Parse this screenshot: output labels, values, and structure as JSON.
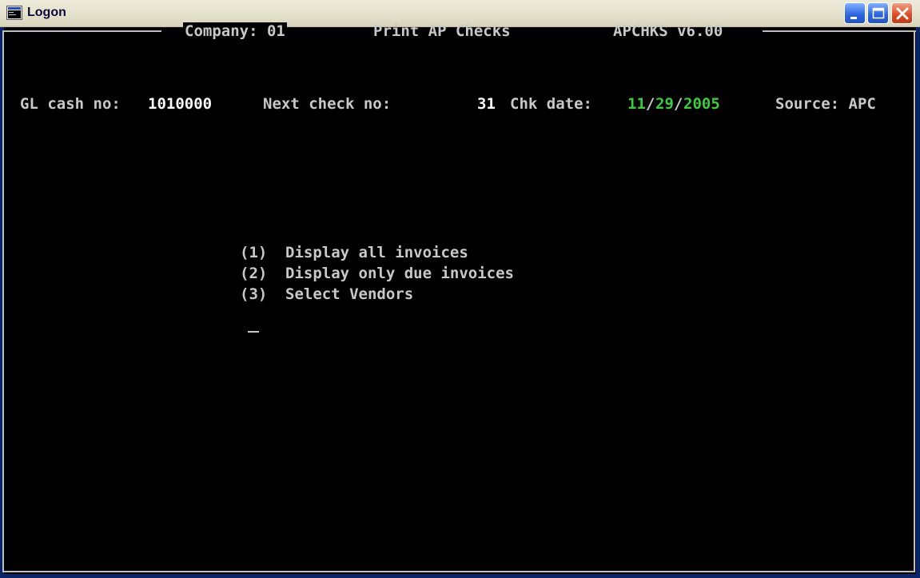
{
  "window": {
    "title": "Logon",
    "icon": "console-window-icon",
    "controls": {
      "minimize": "minimize-icon",
      "maximize": "maximize-icon",
      "close": "close-icon"
    }
  },
  "header": {
    "company": "Company: 01",
    "program_title": "Print AP Checks",
    "program_version": "APCHKS v6.00"
  },
  "info_line": {
    "gl_label": "GL cash no:",
    "gl_value": "1010000",
    "next_check_label": "Next check no:",
    "next_check_value": "31",
    "chk_date_label": "Chk date:",
    "chk_date_month": "11",
    "chk_date_day": "29",
    "chk_date_year": "2005",
    "chk_date_sep1": "/",
    "chk_date_sep2": "/",
    "source": "Source: APC"
  },
  "menu": {
    "items": [
      {
        "key": "(1)",
        "label": "Display all invoices"
      },
      {
        "key": "(2)",
        "label": "Display only due invoices"
      },
      {
        "key": "(3)",
        "label": "Select Vendors"
      }
    ]
  },
  "colors": {
    "background": "#000000",
    "text": "#c8c8c8",
    "highlight": "#ffffff",
    "date": "#3ccc3c"
  }
}
